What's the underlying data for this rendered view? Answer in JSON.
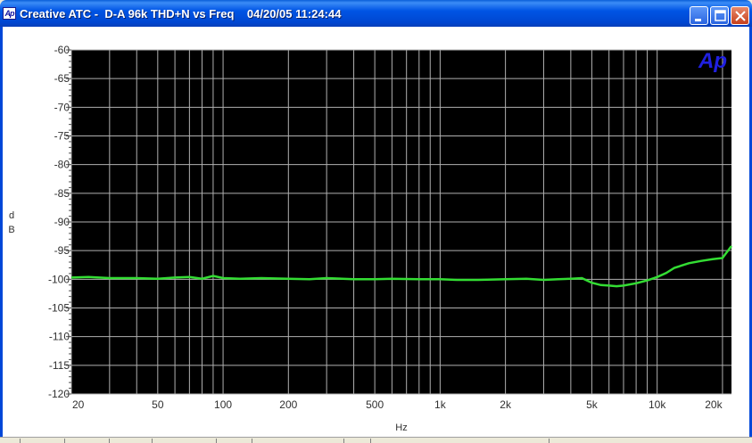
{
  "window": {
    "title": "Creative ATC -  D-A 96k THD+N vs Freq    04/20/05 11:24:44",
    "app_icon_text": "Ap",
    "buttons": [
      "minimize-icon",
      "maximize-icon",
      "close-icon"
    ]
  },
  "logo": {
    "text": "Ap",
    "color": "#2020e0"
  },
  "colors": {
    "trace": "#33dd33",
    "grid": "#b0b0b0",
    "frame": "#0047d8"
  },
  "chart_data": {
    "type": "line",
    "xlabel": "Hz",
    "ylabel": "dB",
    "x_scale": "log",
    "xlim": [
      20,
      22000
    ],
    "ylim": [
      -120,
      -60
    ],
    "grid": true,
    "x_ticks": [
      20,
      50,
      100,
      200,
      500,
      1000,
      2000,
      5000,
      10000,
      20000
    ],
    "x_tick_labels": [
      "20",
      "50",
      "100",
      "200",
      "500",
      "1k",
      "2k",
      "5k",
      "10k",
      "20k"
    ],
    "y_ticks": [
      -60,
      -65,
      -70,
      -75,
      -80,
      -85,
      -90,
      -95,
      -100,
      -105,
      -110,
      -115,
      -120
    ],
    "y_tick_labels": [
      "-60",
      "-65",
      "-70",
      "-75",
      "-80",
      "-85",
      "-90",
      "-95",
      "-100",
      "-105",
      "-110",
      "-115",
      "-120"
    ],
    "series": [
      {
        "color": "#33dd33",
        "x": [
          20,
          24,
          30,
          40,
          50,
          60,
          70,
          80,
          90,
          100,
          120,
          150,
          200,
          250,
          300,
          400,
          500,
          600,
          800,
          1000,
          1200,
          1500,
          2000,
          2500,
          3000,
          3500,
          4000,
          4500,
          5000,
          5500,
          6000,
          6500,
          7000,
          8000,
          9000,
          10000,
          11000,
          12000,
          14000,
          16000,
          18000,
          20000,
          22000
        ],
        "y": [
          -99.7,
          -99.6,
          -99.8,
          -99.8,
          -99.9,
          -99.7,
          -99.6,
          -99.9,
          -99.4,
          -99.8,
          -99.9,
          -99.8,
          -99.9,
          -100.0,
          -99.8,
          -100.0,
          -100.0,
          -99.9,
          -100.0,
          -100.0,
          -100.1,
          -100.1,
          -100.0,
          -99.9,
          -100.1,
          -100.0,
          -99.9,
          -99.8,
          -100.6,
          -101.0,
          -101.1,
          -101.2,
          -101.1,
          -100.7,
          -100.2,
          -99.6,
          -98.9,
          -98.0,
          -97.2,
          -96.8,
          -96.5,
          -96.3,
          -94.2
        ]
      }
    ]
  }
}
